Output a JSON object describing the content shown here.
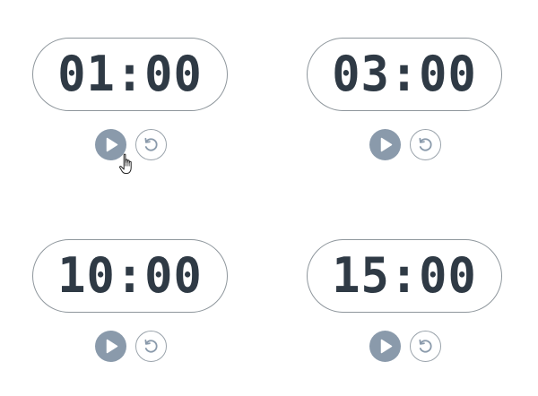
{
  "timers": [
    {
      "time": "01:00"
    },
    {
      "time": "03:00"
    },
    {
      "time": "10:00"
    },
    {
      "time": "15:00"
    }
  ],
  "icons": {
    "play": "play-icon",
    "reset": "reset-icon",
    "cursor": "hand-pointer-icon"
  },
  "colors": {
    "digits": "#2f3a45",
    "border": "#8e969c",
    "play_button": "#8a9aab",
    "reset_icon": "#8a9aab"
  }
}
